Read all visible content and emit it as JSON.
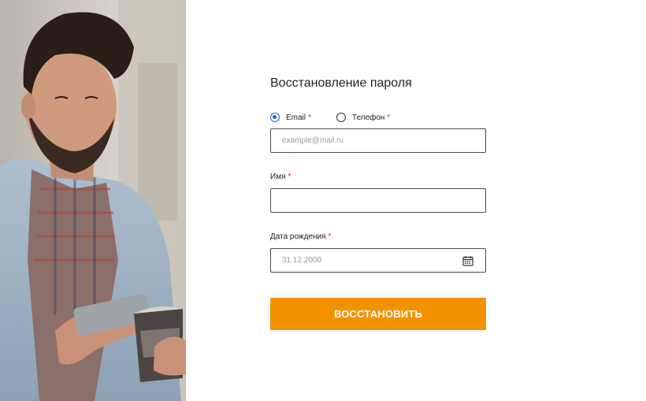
{
  "form": {
    "title": "Восстановление пароля",
    "contact_options": [
      {
        "label": "Email",
        "required_mark": "*",
        "selected": true
      },
      {
        "label": "Телефон",
        "required_mark": "*",
        "selected": false
      }
    ],
    "email": {
      "placeholder": "example@mail.ru",
      "value": ""
    },
    "name": {
      "label": "Имя",
      "required_mark": "*",
      "value": ""
    },
    "birthdate": {
      "label": "Дата рождения",
      "required_mark": "*",
      "placeholder": "31.12.2000",
      "value": "",
      "icon": "calendar-icon"
    },
    "submit_label": "ВОССТАНОВИТЬ"
  },
  "colors": {
    "accent": "#f39200",
    "radio_selected": "#1a66d6",
    "required": "#e0211c"
  }
}
